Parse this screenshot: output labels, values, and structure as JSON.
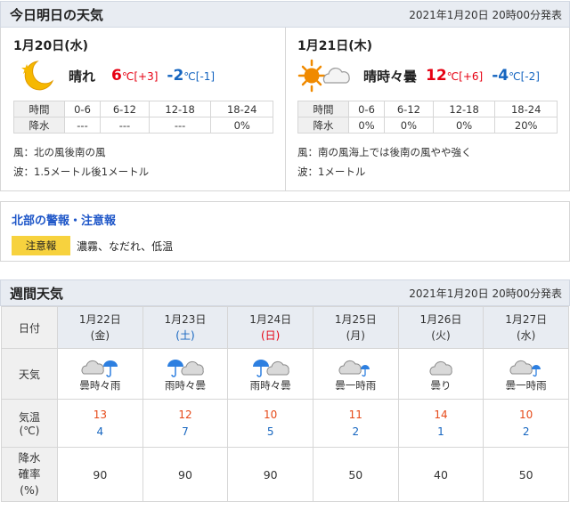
{
  "today_header": {
    "title": "今日明日の天気",
    "issued": "2021年1月20日 20時00分発表"
  },
  "days": [
    {
      "date": "1月20日(水)",
      "icon": "moon-icon",
      "weather": "晴れ",
      "hi": "6",
      "hi_unit": "℃",
      "hi_diff": "[+3]",
      "lo": "-2",
      "lo_unit": "℃",
      "lo_diff": "[-1]",
      "rain_headers": [
        "時間",
        "0-6",
        "6-12",
        "12-18",
        "18-24"
      ],
      "rain_values": [
        "降水",
        "---",
        "---",
        "---",
        "0%"
      ],
      "wind": "風：北の風後南の風",
      "wave": "波：1.5メートル後1メートル"
    },
    {
      "date": "1月21日(木)",
      "icon": "sun-cloud-icon",
      "weather": "晴時々曇",
      "hi": "12",
      "hi_unit": "℃",
      "hi_diff": "[+6]",
      "lo": "-4",
      "lo_unit": "℃",
      "lo_diff": "[-2]",
      "rain_headers": [
        "時間",
        "0-6",
        "6-12",
        "12-18",
        "18-24"
      ],
      "rain_values": [
        "降水",
        "0%",
        "0%",
        "0%",
        "20%"
      ],
      "wind": "風：南の風海上では後南の風やや強く",
      "wave": "波：1メートル"
    }
  ],
  "warnings": {
    "title": "北部の警報・注意報",
    "badge": "注意報",
    "items": "濃霧、なだれ、低温"
  },
  "weekly_header": {
    "title": "週間天気",
    "issued": "2021年1月20日 20時00分発表"
  },
  "weekly": {
    "labels": {
      "date": "日付",
      "weather": "天気",
      "temp_line1": "気温",
      "temp_line2": "(℃)",
      "pop_line1": "降水",
      "pop_line2": "確率",
      "pop_line3": "(%)"
    },
    "days": [
      {
        "date": "1月22日",
        "dow": "(金)",
        "dow_type": "weekday",
        "icon": "cloud-rain-icon",
        "weather": "曇時々雨",
        "hi": "13",
        "lo": "4",
        "pop": "90"
      },
      {
        "date": "1月23日",
        "dow": "(土)",
        "dow_type": "sat",
        "icon": "rain-cloud-icon",
        "weather": "雨時々曇",
        "hi": "12",
        "lo": "7",
        "pop": "90"
      },
      {
        "date": "1月24日",
        "dow": "(日)",
        "dow_type": "sun",
        "icon": "rain-cloud-icon",
        "weather": "雨時々曇",
        "hi": "10",
        "lo": "5",
        "pop": "90"
      },
      {
        "date": "1月25日",
        "dow": "(月)",
        "dow_type": "weekday",
        "icon": "cloud-rain-small-icon",
        "weather": "曇一時雨",
        "hi": "11",
        "lo": "2",
        "pop": "50"
      },
      {
        "date": "1月26日",
        "dow": "(火)",
        "dow_type": "weekday",
        "icon": "cloud-icon",
        "weather": "曇り",
        "hi": "14",
        "lo": "1",
        "pop": "40"
      },
      {
        "date": "1月27日",
        "dow": "(水)",
        "dow_type": "weekday",
        "icon": "cloud-rain-small-icon",
        "weather": "曇一時雨",
        "hi": "10",
        "lo": "2",
        "pop": "50"
      }
    ]
  },
  "colors": {
    "hi": "#e60012",
    "lo": "#1565c0",
    "header_bg": "#e8ecf2",
    "warn_badge": "#f7d23e",
    "link": "#1e56c8"
  }
}
